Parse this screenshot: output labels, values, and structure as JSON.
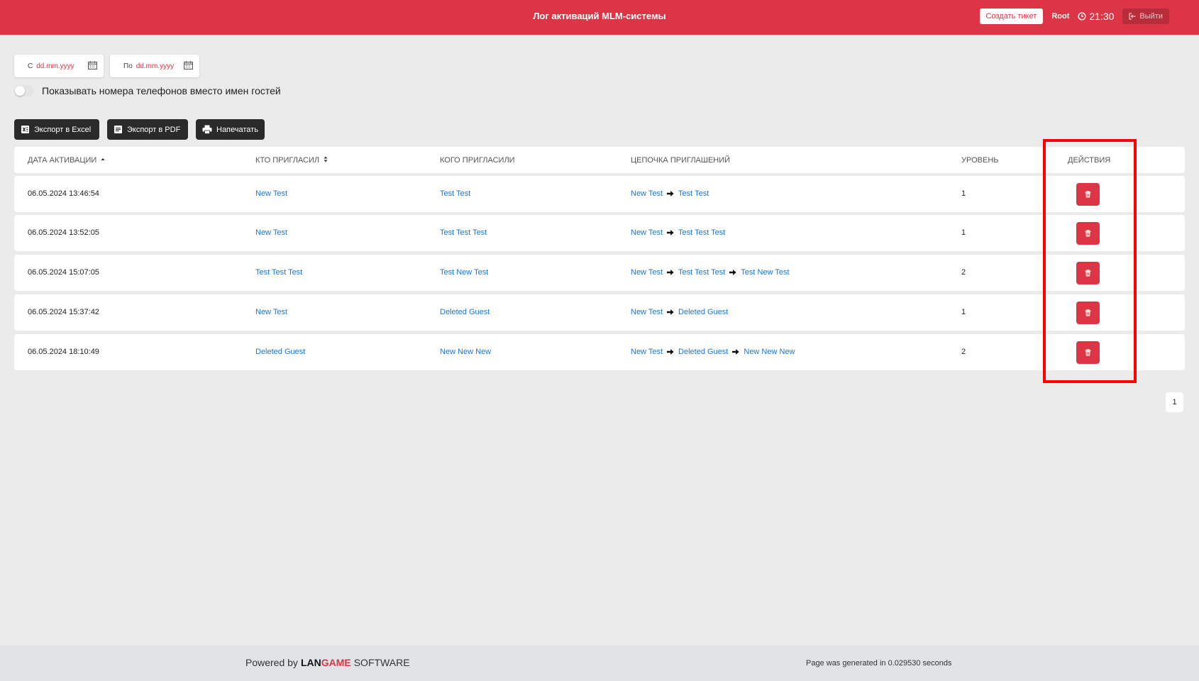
{
  "header": {
    "title": "Лог активаций MLM-системы",
    "ticket_button": "Создать тикет",
    "user": "Root",
    "time": "21:30",
    "logout_button": "Выйти"
  },
  "filters": {
    "from_label": "С",
    "from_value": "dd.mm.yyyy",
    "to_label": "По",
    "to_value": "dd.mm.yyyy",
    "toggle_label": "Показывать номера телефонов вместо имен гостей",
    "toggle_on": false
  },
  "export": {
    "excel": "Экспорт в Excel",
    "pdf": "Экспорт в PDF",
    "print": "Напечатать"
  },
  "table": {
    "headers": [
      "ДАТА АКТИВАЦИИ",
      "КТО ПРИГЛАСИЛ",
      "КОГО ПРИГЛАСИЛИ",
      "ЦЕПОЧКА ПРИГЛАШЕНИЙ",
      "УРОВЕНЬ",
      "ДЕЙСТВИЯ"
    ],
    "rows": [
      {
        "date": "06.05.2024 13:46:54",
        "inviter": "New Test",
        "invited": "Test Test",
        "chain": [
          "New Test",
          "Test Test"
        ],
        "level": "1"
      },
      {
        "date": "06.05.2024 13:52:05",
        "inviter": "New Test",
        "invited": "Test Test Test",
        "chain": [
          "New Test",
          "Test Test Test"
        ],
        "level": "1"
      },
      {
        "date": "06.05.2024 15:07:05",
        "inviter": "Test Test Test",
        "invited": "Test New Test",
        "chain": [
          "New Test",
          "Test Test Test",
          "Test New Test"
        ],
        "level": "2"
      },
      {
        "date": "06.05.2024 15:37:42",
        "inviter": "New Test",
        "invited": "Deleted Guest",
        "chain": [
          "New Test",
          "Deleted Guest"
        ],
        "level": "1"
      },
      {
        "date": "06.05.2024 18:10:49",
        "inviter": "Deleted Guest",
        "invited": "New New New",
        "chain": [
          "New Test",
          "Deleted Guest",
          "New New New"
        ],
        "level": "2"
      }
    ]
  },
  "pagination": {
    "current_page": "1"
  },
  "footer": {
    "powered_by": "Powered by",
    "logo_part1": "LAN",
    "logo_part2": "GAME",
    "logo_part3": "SOFTWARE",
    "generated": "Page was generated in 0.029530 seconds"
  },
  "colors": {
    "primary": "#dc3545",
    "link": "#1976d2",
    "highlight": "#ff0000"
  }
}
